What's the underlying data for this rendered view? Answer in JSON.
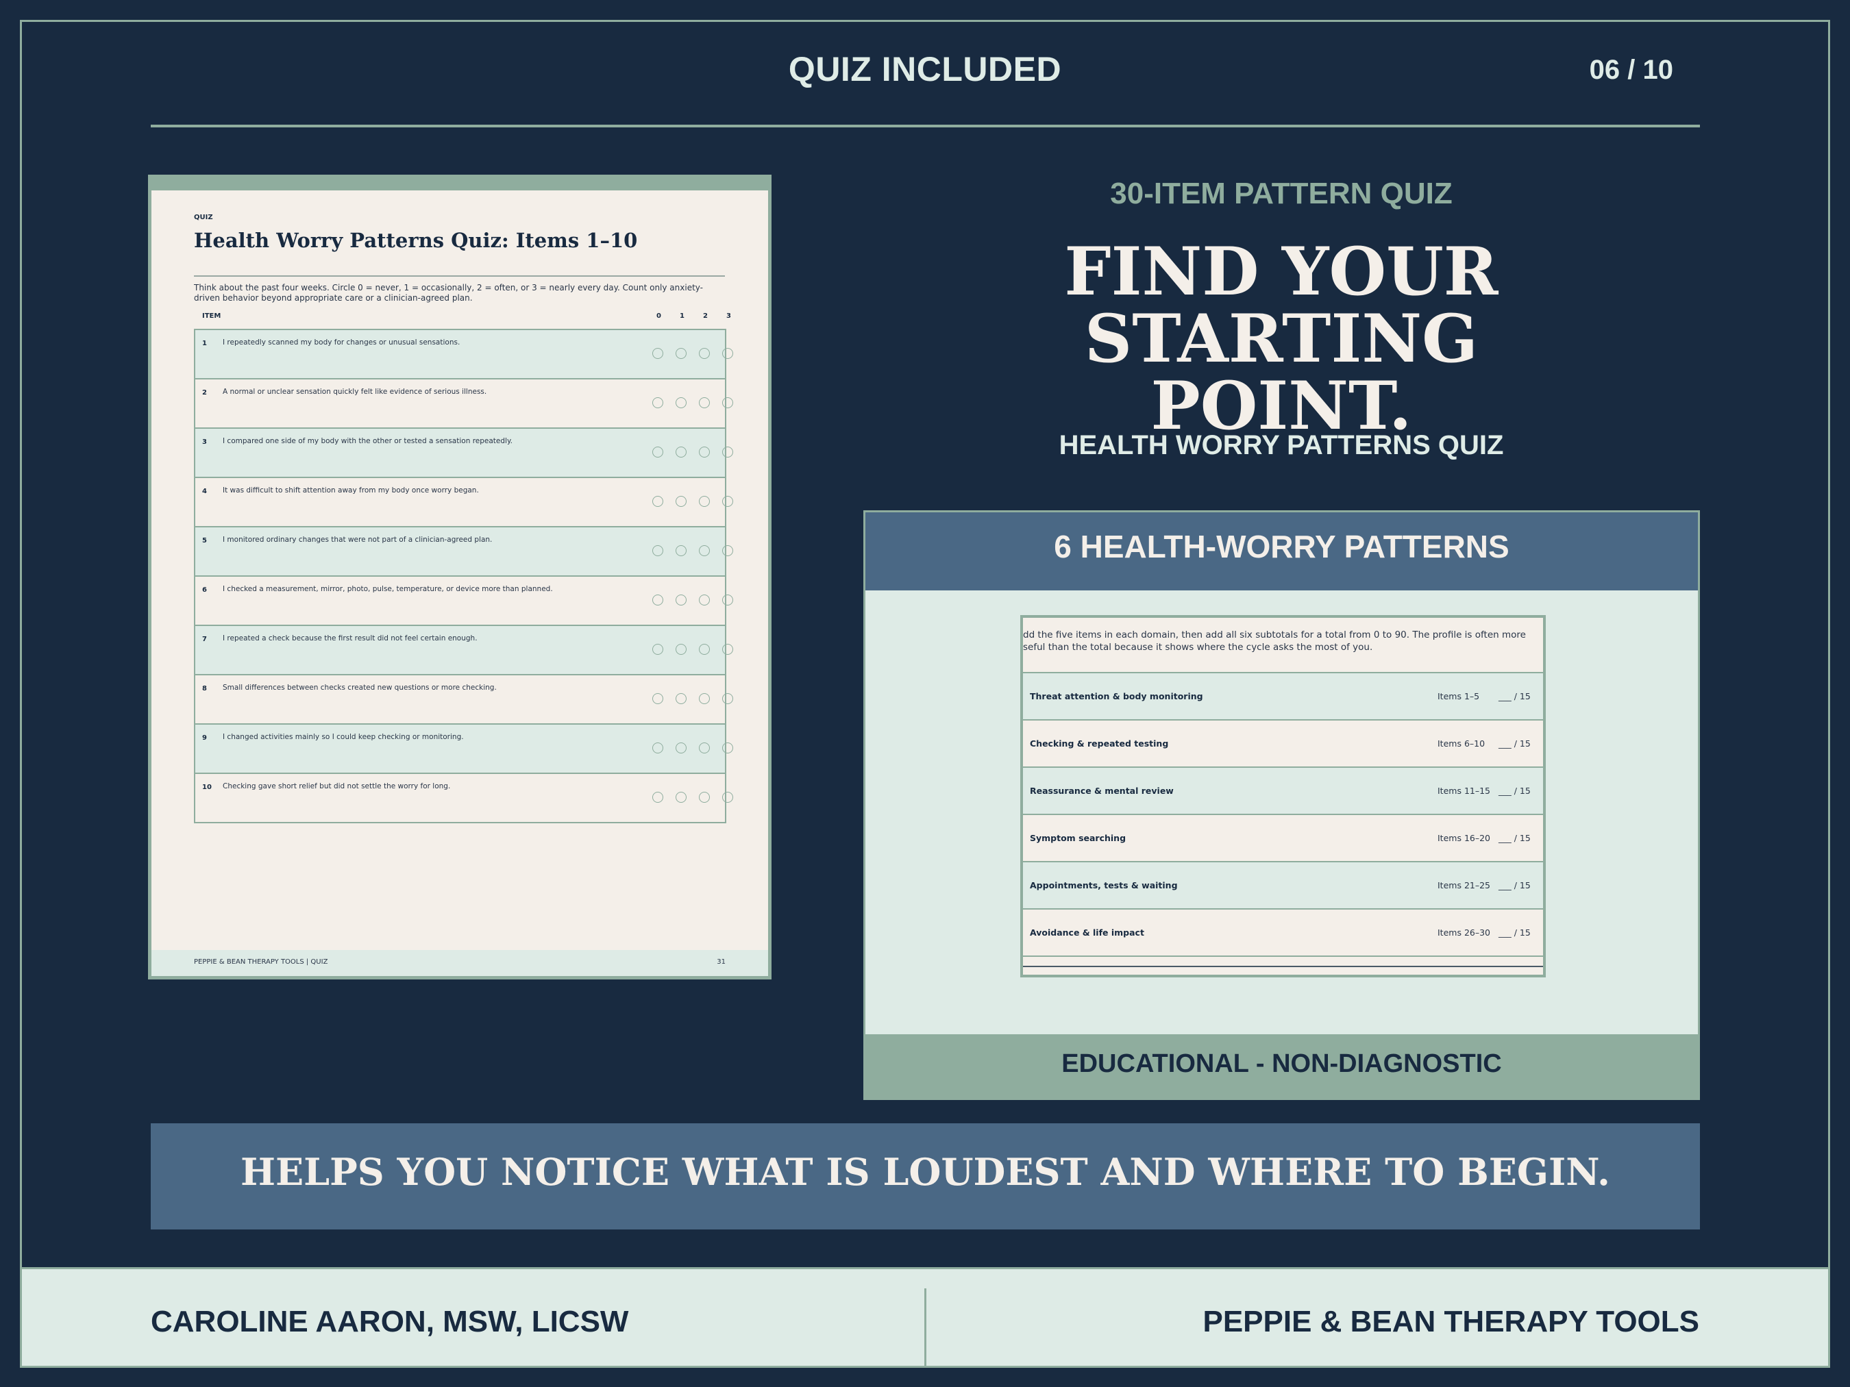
{
  "header": {
    "title": "QUIZ INCLUDED",
    "page_counter": "06 / 10"
  },
  "document": {
    "kicker": "QUIZ",
    "title": "Health Worry Patterns Quiz: Items 1–10",
    "instructions": "Think about the past four weeks. Circle 0 = never, 1 = occasionally, 2 = often, or 3 = nearly every day. Count only anxiety-driven behavior beyond appropriate care or a clinician-agreed plan.",
    "column_item": "ITEM",
    "scale": [
      "0",
      "1",
      "2",
      "3"
    ],
    "items": [
      {
        "num": "1",
        "text": "I repeatedly scanned my body for changes or unusual sensations."
      },
      {
        "num": "2",
        "text": "A normal or unclear sensation quickly felt like evidence of serious illness."
      },
      {
        "num": "3",
        "text": "I compared one side of my body with the other or tested a sensation repeatedly."
      },
      {
        "num": "4",
        "text": "It was difficult to shift attention away from my body once worry began."
      },
      {
        "num": "5",
        "text": "I monitored ordinary changes that were not part of a clinician-agreed plan."
      },
      {
        "num": "6",
        "text": "I checked a measurement, mirror, photo, pulse, temperature, or device more than planned."
      },
      {
        "num": "7",
        "text": "I repeated a check because the first result did not feel certain enough."
      },
      {
        "num": "8",
        "text": "Small differences between checks created new questions or more checking."
      },
      {
        "num": "9",
        "text": "I changed activities mainly so I could keep checking or monitoring."
      },
      {
        "num": "10",
        "text": "Checking gave short relief but did not settle the worry for long."
      }
    ],
    "footer_left": "PEPPIE & BEAN THERAPY TOOLS  |  QUIZ",
    "footer_page": "31"
  },
  "right": {
    "eyebrow": "30-ITEM PATTERN QUIZ",
    "headline_line1": "FIND YOUR STARTING",
    "headline_line2": "POINT.",
    "subhead": "HEALTH WORRY PATTERNS QUIZ"
  },
  "panel": {
    "title": "6 HEALTH-WORRY PATTERNS",
    "intro_line1": "dd the five items in each domain, then add all six subtotals for a total from 0 to 90. The profile is often more",
    "intro_line2": "seful than the total because it shows where the cycle asks the most of you.",
    "domains": [
      {
        "name": "Threat attention & body monitoring",
        "items": "Items 1–5",
        "blank": "___ / 15"
      },
      {
        "name": "Checking & repeated testing",
        "items": "Items 6–10",
        "blank": "___ / 15"
      },
      {
        "name": "Reassurance & mental review",
        "items": "Items 11–15",
        "blank": "___ / 15"
      },
      {
        "name": "Symptom searching",
        "items": "Items 16–20",
        "blank": "___ / 15"
      },
      {
        "name": "Appointments, tests & waiting",
        "items": "Items 21–25",
        "blank": "___ / 15"
      },
      {
        "name": "Avoidance & life impact",
        "items": "Items 26–30",
        "blank": "___ / 15"
      }
    ],
    "footer": "EDUCATIONAL - NON-DIAGNOSTIC"
  },
  "banner": "HELPS YOU NOTICE WHAT IS LOUDEST AND WHERE TO BEGIN.",
  "footer": {
    "author": "CAROLINE AARON, MSW, LICSW",
    "brand": "PEPPIE & BEAN THERAPY TOOLS"
  },
  "colors": {
    "background": "#182a40",
    "sage": "#8fad9e",
    "slate_blue": "#4a6885",
    "cream": "#f4efe9",
    "mint": "#deebe6"
  }
}
